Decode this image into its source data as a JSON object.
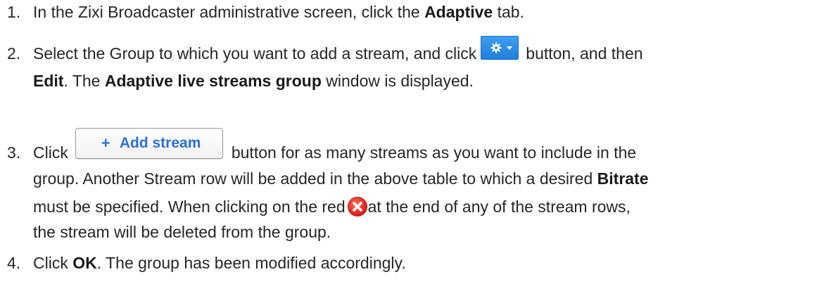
{
  "steps": [
    {
      "number": "1.",
      "line1_pre": "In the Zixi Broadcaster administrative screen, click the ",
      "line1_bold": "Adaptive",
      "line1_post": " tab."
    },
    {
      "number": "2.",
      "line1_pre": "Select the Group to which you want to add a stream, and click",
      "line1_post": "button, and then",
      "line2_bold1": "Edit",
      "line2_mid": ". The ",
      "line2_bold2": "Adaptive live streams group",
      "line2_post": " window is displayed.",
      "gear_button_icon": "gear-icon"
    },
    {
      "number": "3.",
      "line1_pre": "Click",
      "add_button": {
        "plus": "+",
        "label": "Add stream"
      },
      "line1_post": "button for as many streams as you want to include in the",
      "line2_pre": "group. Another Stream row will be added in the above table to which a desired ",
      "line2_bold": "Bitrate",
      "line3_pre": "must be specified. When clicking on the red",
      "line3_post": "at the end of any of the stream rows,",
      "line4": "the stream will be deleted from the group.",
      "delete_icon": "red-x-circle-icon"
    },
    {
      "number": "4.",
      "line1_pre": "Click ",
      "line1_bold": "OK",
      "line1_post": ". The group has been modified accordingly."
    }
  ],
  "colors": {
    "text": "#262626",
    "gear_button": "#2b8ae6",
    "add_button_text": "#2a6fd6",
    "delete_icon": "#e5251d"
  }
}
